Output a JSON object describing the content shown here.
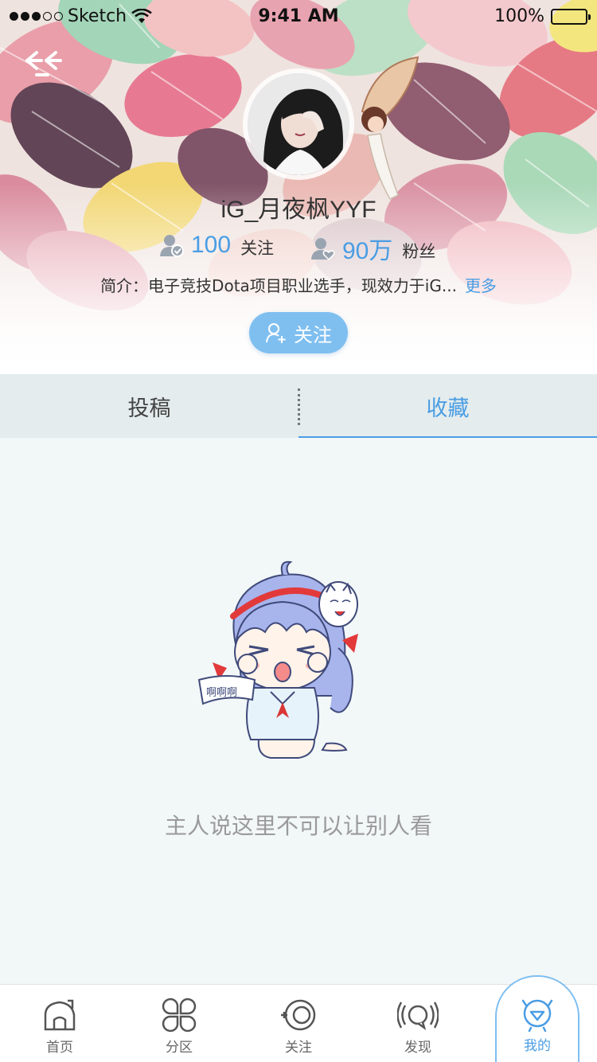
{
  "status_bar": {
    "carrier": "Sketch",
    "time": "9:41 AM",
    "battery": "100%"
  },
  "profile": {
    "username": "iG_月夜枫YYF",
    "following_count": "100",
    "following_label": "关注",
    "fans_count": "90万",
    "fans_label": "粉丝",
    "bio": "简介：电子竞技Dota项目职业选手，现效力于iG...",
    "more_label": "更多",
    "follow_button": "关注"
  },
  "tabs": [
    {
      "label": "投稿",
      "active": false
    },
    {
      "label": "收藏",
      "active": true
    }
  ],
  "empty_state": {
    "message": "主人说这里不可以让别人看",
    "speech_text": "啊啊啊"
  },
  "bottom_nav": [
    {
      "label": "首页",
      "icon": "home-icon"
    },
    {
      "label": "分区",
      "icon": "category-icon"
    },
    {
      "label": "关注",
      "icon": "follow-icon"
    },
    {
      "label": "发现",
      "icon": "discover-icon"
    },
    {
      "label": "我的",
      "icon": "profile-icon",
      "active": true
    }
  ],
  "colors": {
    "accent": "#4a9de4",
    "follow_button": "#7fbff0",
    "tab_bg": "#e4eced",
    "content_bg": "#f2f7f8"
  }
}
